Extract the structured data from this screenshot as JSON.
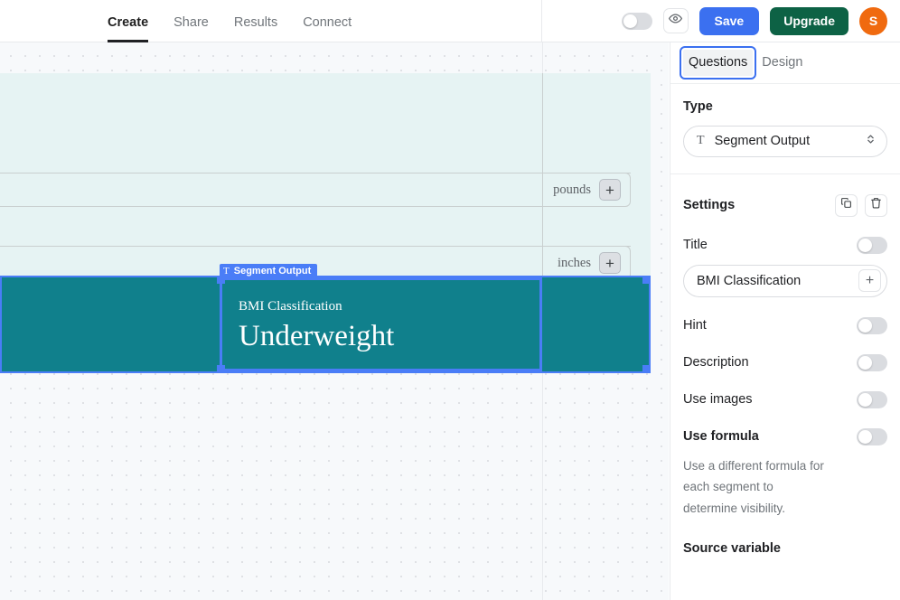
{
  "header": {
    "nav_tabs": [
      {
        "label": "Create",
        "active": true
      },
      {
        "label": "Share",
        "active": false
      },
      {
        "label": "Results",
        "active": false
      },
      {
        "label": "Connect",
        "active": false
      }
    ],
    "preview_toggle": {
      "name": "preview-toggle",
      "state": "off"
    },
    "eye_icon": "eye-icon",
    "save_label": "Save",
    "upgrade_label": "Upgrade",
    "avatar_initial": "S"
  },
  "canvas": {
    "rows": [
      {
        "unit": "pounds",
        "plus": "+"
      },
      {
        "unit": "inches",
        "plus": "+"
      }
    ],
    "segment": {
      "badge_label": "Segment Output",
      "badge_icon": "text-type-icon",
      "title": "BMI Classification",
      "value": "Underweight",
      "fill_color": "#10808c",
      "selection_color": "#4a7df7"
    },
    "form_background": "#e6f3f3"
  },
  "panel": {
    "tabs": [
      {
        "label": "Questions",
        "active": true
      },
      {
        "label": "Design",
        "active": false
      }
    ],
    "type": {
      "label": "Type",
      "selected": "Segment Output",
      "icon": "text-type-icon"
    },
    "settings": {
      "label": "Settings",
      "duplicate_icon": "duplicate-icon",
      "delete_icon": "trash-icon"
    },
    "fields": [
      {
        "label": "Title",
        "toggle": "off"
      },
      {
        "label": "Hint",
        "toggle": "off"
      },
      {
        "label": "Description",
        "toggle": "off"
      },
      {
        "label": "Use images",
        "toggle": "off"
      },
      {
        "label": "Use formula",
        "toggle": "off"
      }
    ],
    "title_value": "BMI Classification",
    "title_add_icon": "+",
    "formula_helper": "Use a different formula for each segment to determine visibility.",
    "source_variable_label": "Source variable"
  }
}
